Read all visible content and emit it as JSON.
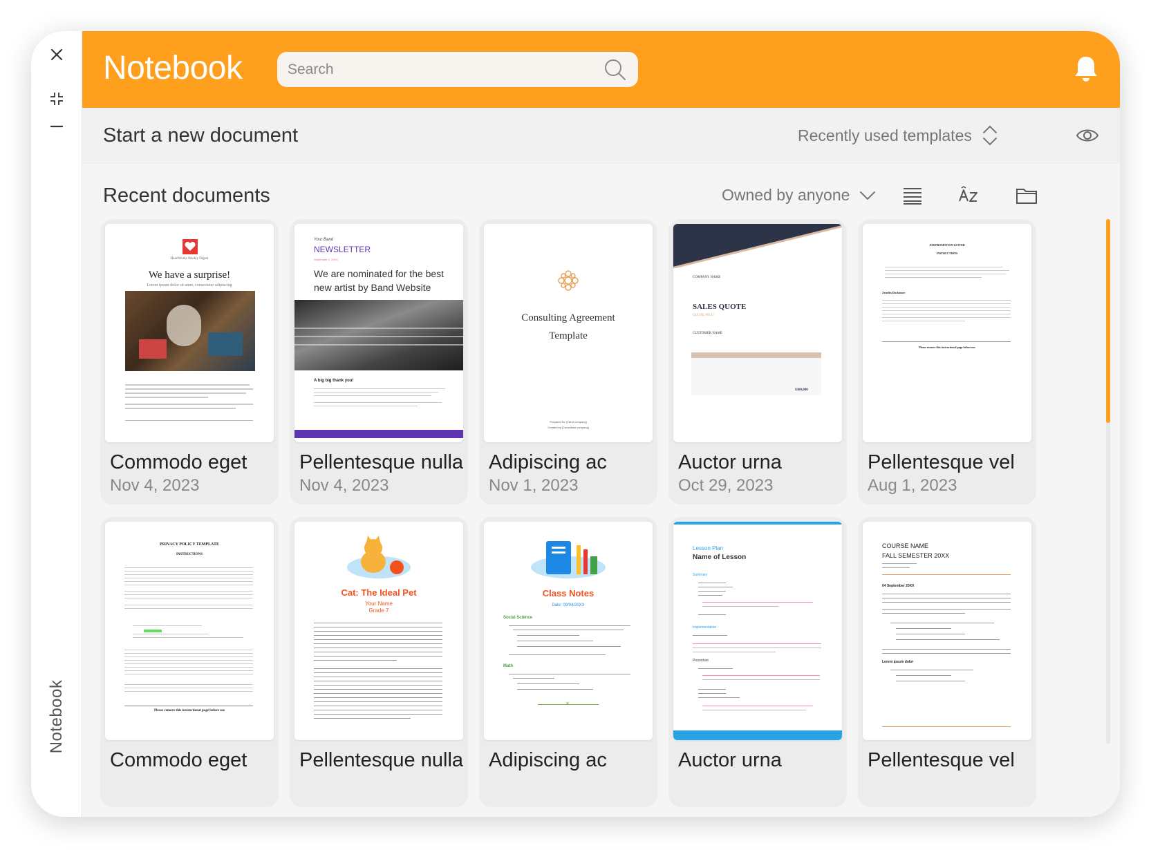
{
  "window_controls": {
    "close_icon": "close-icon",
    "collapse_icon": "collapse-icon",
    "minimize_icon": "minimize-icon"
  },
  "sidebar": {
    "label": "Notebook"
  },
  "header": {
    "app_title": "Notebook",
    "search_placeholder": "Search",
    "bell_icon": "bell-icon"
  },
  "new_document": {
    "title": "Start a new document",
    "templates_select": "Recently used templates"
  },
  "recent": {
    "title": "Recent documents",
    "owner_select": "Owned by anyone"
  },
  "colors": {
    "accent": "#ff9f1e",
    "background": "#f5f5f5",
    "card": "#ececec"
  },
  "cards": [
    {
      "title": "Commodo eget",
      "date": "Nov 4, 2023"
    },
    {
      "title": "Pellentesque nulla",
      "date": "Nov 4, 2023"
    },
    {
      "title": "Adipiscing ac",
      "date": "Nov 1, 2023"
    },
    {
      "title": "Auctor urna",
      "date": "Oct 29, 2023"
    },
    {
      "title": "Pellentesque vel",
      "date": "Aug 1, 2023"
    },
    {
      "title": "Commodo eget"
    },
    {
      "title": "Pellentesque nulla"
    },
    {
      "title": "Adipiscing ac"
    },
    {
      "title": "Auctor urna"
    },
    {
      "title": "Pellentesque vel"
    }
  ],
  "thumbs": {
    "t1": {
      "brand": "HeartWorks Weekly Digest",
      "headline": "We have a surprise!",
      "sub": "Lorem ipsum dolor sit amet, consectetur adipiscing"
    },
    "t2": {
      "kicker": "Your Band",
      "masthead": "NEWSLETTER",
      "date": "September 4, 20XX",
      "headline": "We are nominated for the best new artist by Band Website",
      "section": "A big big thank you!"
    },
    "t3": {
      "title_line1": "Consulting Agreement",
      "title_line2": "Template",
      "prepared_for": "Prepared for [Client company]",
      "created_by": "Created by [Consultant company]"
    },
    "t4": {
      "company": "COMPANY NAME",
      "doc_title": "SALES QUOTE",
      "quote_no": "QUOTE #0135",
      "customer": "CUSTOMER NAME",
      "total": "$380,000"
    },
    "t5": {
      "title": "JOB PROMOTION LETTER",
      "subtitle": "INSTRUCTIONS",
      "section": "Zenefits Disclaimer",
      "footer": "Please remove this instructional page before use"
    },
    "t6": {
      "title": "PRIVACY POLICY TEMPLATE",
      "subtitle": "INSTRUCTIONS",
      "footer": "Please remove this instructional page before use"
    },
    "t7": {
      "title": "Cat: The Ideal Pet",
      "name": "Your Name",
      "grade": "Grade 7"
    },
    "t8": {
      "title": "Class Notes",
      "date": "Date: 09/04/20XX",
      "sec1": "Social Science",
      "sec2": "Math"
    },
    "t9": {
      "kicker": "Lesson Plan",
      "title": "Name of Lesson",
      "summary": "Summary",
      "implementation": "Implementation",
      "procedure": "Procedure"
    },
    "t10": {
      "course": "COURSE NAME",
      "semester": "FALL SEMESTER 20XX",
      "date": "04 September 20XX",
      "section": "Lorem ipsum dolor"
    }
  }
}
